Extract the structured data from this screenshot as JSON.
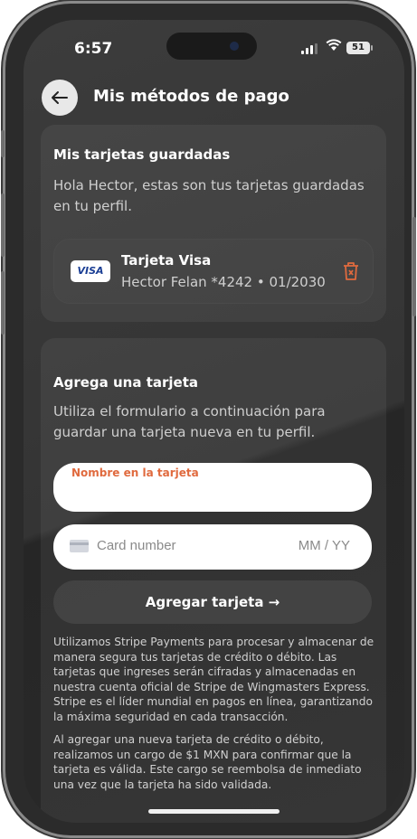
{
  "status": {
    "time": "6:57",
    "battery": "51"
  },
  "header": {
    "back_icon": "arrow-left-icon",
    "title": "Mis métodos de pago"
  },
  "saved_cards": {
    "heading": "Mis tarjetas guardadas",
    "description": "Hola Hector, estas son tus tarjetas guardadas en tu perfil.",
    "items": [
      {
        "brand": "VISA",
        "title": "Tarjeta Visa",
        "detail": "Hector Felan *4242 • 01/2030",
        "delete_icon": "trash-icon"
      }
    ]
  },
  "add_card": {
    "heading": "Agrega una tarjeta",
    "description": "Utiliza el formulario a continuación para guardar una tarjeta nueva en tu perfil.",
    "name_field_label": "Nombre en la tarjeta",
    "name_field_value": "",
    "card_number_placeholder": "Card number",
    "expiry_placeholder": "MM / YY",
    "submit_label": "Agregar tarjeta →",
    "disclaimer_1": "Utilizamos Stripe Payments para procesar y almacenar de manera segura tus tarjetas de crédito o débito. Las tarjetas que ingreses serán cifradas y almacenadas en nuestra cuenta oficial de Stripe de Wingmasters Express. Stripe es el líder mundial en pagos en línea, garantizando la máxima seguridad en cada transacción.",
    "disclaimer_2": "Al agregar una nueva tarjeta de crédito o débito, realizamos un cargo de $1 MXN para confirmar que la tarjeta es válida. Este cargo se reembolsa de inmediato una vez que la tarjeta ha sido validada."
  },
  "colors": {
    "accent": "#e06a3e",
    "background": "#333333",
    "visa_blue": "#1a3e94"
  }
}
